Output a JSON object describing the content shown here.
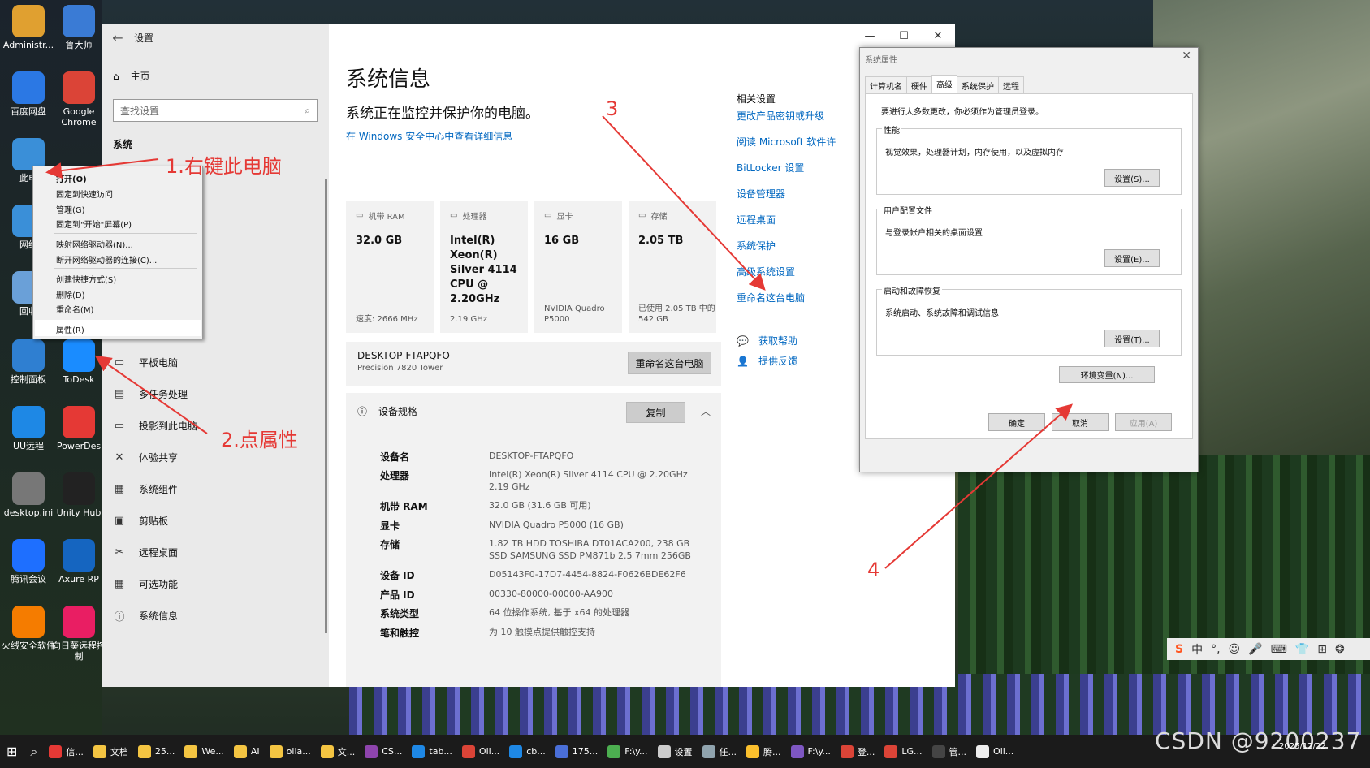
{
  "desktop": {
    "icons": [
      {
        "label": "Administr...",
        "color": "#e0a030",
        "glyph": "user-folder-icon"
      },
      {
        "label": "鲁大师",
        "color": "#3a7bd5",
        "glyph": "ludashi-icon"
      },
      {
        "label": "百度网盘",
        "color": "#2b78e4",
        "glyph": "baidu-netdisk-icon"
      },
      {
        "label": "Google Chrome",
        "color": "#db4437",
        "glyph": "chrome-icon"
      },
      {
        "label": "此电",
        "color": "#3a8fd8",
        "glyph": "this-pc-icon"
      },
      {
        "label": "网络",
        "color": "#3a8fd8",
        "glyph": "network-icon"
      },
      {
        "label": "回收",
        "color": "#6aa0d8",
        "glyph": "recycle-bin-icon"
      },
      {
        "label": "控制面板",
        "color": "#2f7fd1",
        "glyph": "control-panel-icon"
      },
      {
        "label": "ToDesk",
        "color": "#1a8cff",
        "glyph": "todesk-icon"
      },
      {
        "label": "UU远程",
        "color": "#1e88e5",
        "glyph": "uu-remote-icon"
      },
      {
        "label": "PowerDes",
        "color": "#e53935",
        "glyph": "powerdesigner-icon"
      },
      {
        "label": "desktop.ini",
        "color": "#777777",
        "glyph": "ini-file-icon"
      },
      {
        "label": "Unity Hub",
        "color": "#222222",
        "glyph": "unity-hub-icon"
      },
      {
        "label": "腾讯会议",
        "color": "#1e6fff",
        "glyph": "tencent-meeting-icon"
      },
      {
        "label": "Axure RP",
        "color": "#1565c0",
        "glyph": "axure-icon"
      },
      {
        "label": "火绒安全软件",
        "color": "#f57c00",
        "glyph": "huorong-icon"
      },
      {
        "label": "向日葵远程控制",
        "color": "#e91e63",
        "glyph": "sunlogin-icon"
      }
    ]
  },
  "settings": {
    "title": "设置",
    "home": "主页",
    "search_placeholder": "查找设置",
    "section": "系统",
    "nav": [
      "平板电脑",
      "多任务处理",
      "投影到此电脑",
      "体验共享",
      "系统组件",
      "剪贴板",
      "远程桌面",
      "可选功能",
      "系统信息"
    ],
    "heading": "系统信息",
    "subheading": "系统正在监控并保护你的电脑。",
    "security_link": "在 Windows 安全中心中查看详细信息",
    "cards": [
      {
        "type": "机带 RAM",
        "value": "32.0 GB",
        "foot": "速度: 2666 MHz"
      },
      {
        "type": "处理器",
        "value": "Intel(R) Xeon(R) Silver 4114 CPU @ 2.20GHz",
        "foot": "2.19 GHz"
      },
      {
        "type": "显卡",
        "value": "16 GB",
        "foot": "NVIDIA Quadro P5000"
      },
      {
        "type": "存储",
        "value": "2.05 TB",
        "foot": "已使用 2.05 TB 中的 542 GB"
      }
    ],
    "device_name": "DESKTOP-FTAPQFO",
    "device_model": "Precision 7820 Tower",
    "rename_button": "重命名这台电脑",
    "spec_title": "设备规格",
    "copy_button": "复制",
    "specs": [
      {
        "k": "设备名",
        "v": "DESKTOP-FTAPQFO"
      },
      {
        "k": "处理器",
        "v": "Intel(R) Xeon(R) Silver 4114 CPU @ 2.20GHz 2.19 GHz"
      },
      {
        "k": "机带 RAM",
        "v": "32.0 GB (31.6 GB 可用)"
      },
      {
        "k": "显卡",
        "v": "NVIDIA Quadro P5000 (16 GB)"
      },
      {
        "k": "存储",
        "v": "1.82 TB HDD TOSHIBA DT01ACA200, 238 GB SSD SAMSUNG SSD PM871b 2.5 7mm 256GB"
      },
      {
        "k": "设备 ID",
        "v": "D05143F0-17D7-4454-8824-F0626BDE62F6"
      },
      {
        "k": "产品 ID",
        "v": "00330-80000-00000-AA900"
      },
      {
        "k": "系统类型",
        "v": "64 位操作系统, 基于 x64 的处理器"
      },
      {
        "k": "笔和触控",
        "v": "为 10 触摸点提供触控支持"
      }
    ],
    "related_title": "相关设置",
    "related": [
      "更改产品密钥或升级",
      "阅读 Microsoft 软件许",
      "BitLocker 设置",
      "设备管理器",
      "远程桌面",
      "系统保护",
      "高级系统设置",
      "重命名这台电脑"
    ],
    "help": "获取帮助",
    "feedback": "提供反馈"
  },
  "context_menu": {
    "items": [
      "打开(O)",
      "固定到快速访问",
      "管理(G)",
      "固定到\"开始\"屏幕(P)",
      "映射网络驱动器(N)...",
      "断开网络驱动器的连接(C)...",
      "创建快捷方式(S)",
      "删除(D)",
      "重命名(M)",
      "属性(R)"
    ]
  },
  "sysprops": {
    "title": "系统属性",
    "tabs": [
      "计算机名",
      "硬件",
      "高级",
      "系统保护",
      "远程"
    ],
    "admin_note": "要进行大多数更改，你必须作为管理员登录。",
    "groups": [
      {
        "label": "性能",
        "desc": "视觉效果，处理器计划，内存使用，以及虚拟内存",
        "button": "设置(S)..."
      },
      {
        "label": "用户配置文件",
        "desc": "与登录帐户相关的桌面设置",
        "button": "设置(E)..."
      },
      {
        "label": "启动和故障恢复",
        "desc": "系统启动、系统故障和调试信息",
        "button": "设置(T)..."
      }
    ],
    "env_button": "环境变量(N)...",
    "ok": "确定",
    "cancel": "取消",
    "apply": "应用(A)"
  },
  "annotations": {
    "a1": "1.右键此电脑",
    "a2": "2.点属性",
    "a3": "3",
    "a4": "4",
    "color": "#e53935"
  },
  "taskbar": {
    "items": [
      {
        "label": "信...",
        "color": "#e53935"
      },
      {
        "label": "文档",
        "color": "#f4c542"
      },
      {
        "label": "25...",
        "color": "#f4c542"
      },
      {
        "label": "We...",
        "color": "#f4c542"
      },
      {
        "label": "AI",
        "color": "#f4c542"
      },
      {
        "label": "olla...",
        "color": "#f4c542"
      },
      {
        "label": "文...",
        "color": "#f4c542"
      },
      {
        "label": "CS...",
        "color": "#8e44ad"
      },
      {
        "label": "tab...",
        "color": "#1e88e5"
      },
      {
        "label": "Oll...",
        "color": "#db4437"
      },
      {
        "label": "cb...",
        "color": "#1e88e5"
      },
      {
        "label": "175...",
        "color": "#4a6fd8"
      },
      {
        "label": "F:\\y...",
        "color": "#4caf50"
      },
      {
        "label": "设置",
        "color": "#cccccc"
      },
      {
        "label": "任...",
        "color": "#90a4ae"
      },
      {
        "label": "腾...",
        "color": "#fbc02d"
      },
      {
        "label": "F:\\y...",
        "color": "#7e57c2"
      },
      {
        "label": "登...",
        "color": "#db4437"
      },
      {
        "label": "LG...",
        "color": "#db4437"
      },
      {
        "label": "管...",
        "color": "#444444"
      },
      {
        "label": "Oll...",
        "color": "#eeeeee"
      }
    ],
    "date": "2025/12/22"
  },
  "watermark": "CSDN @9200237"
}
